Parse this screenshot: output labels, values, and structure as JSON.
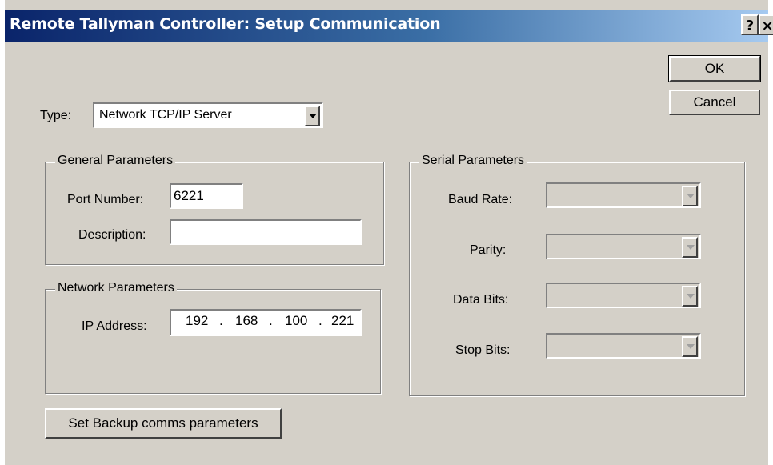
{
  "window": {
    "title": "Remote Tallyman Controller: Setup Communication",
    "help_label": "?",
    "close_label": "×"
  },
  "buttons": {
    "ok": "OK",
    "cancel": "Cancel",
    "backup": "Set Backup comms parameters"
  },
  "type": {
    "label": "Type:",
    "value": "Network TCP/IP Server"
  },
  "general": {
    "title": "General Parameters",
    "port_label": "Port Number:",
    "port_value": "6221",
    "desc_label": "Description:",
    "desc_value": ""
  },
  "network": {
    "title": "Network Parameters",
    "ip_label": "IP Address:",
    "ip": [
      "192",
      "168",
      "100",
      "221"
    ],
    "dot": "."
  },
  "serial": {
    "title": "Serial Parameters",
    "baud_label": "Baud Rate:",
    "parity_label": "Parity:",
    "databits_label": "Data Bits:",
    "stopbits_label": "Stop Bits:"
  }
}
